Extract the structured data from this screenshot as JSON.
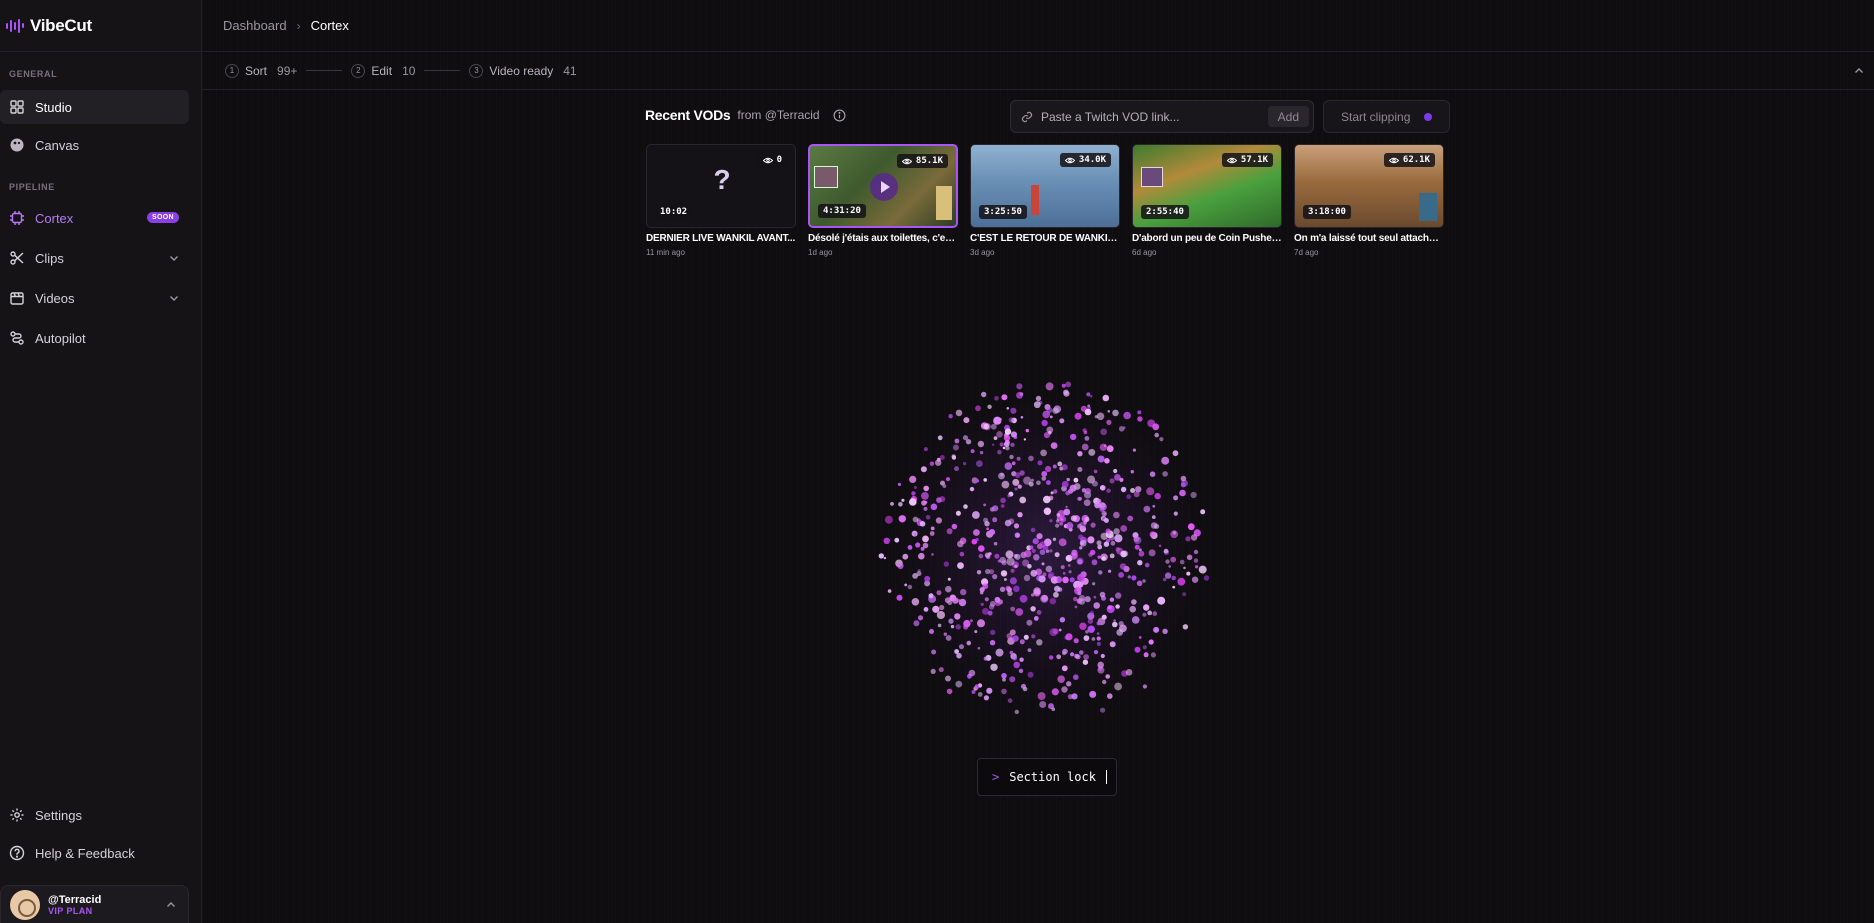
{
  "app": {
    "name": "VibeCut",
    "brand_color": "#a855f7"
  },
  "sidebar": {
    "general_label": "GENERAL",
    "pipeline_label": "PIPELINE",
    "items": [
      {
        "label": "Studio",
        "icon": "grid-icon"
      },
      {
        "label": "Canvas",
        "icon": "canvas-icon"
      },
      {
        "label": "Cortex",
        "icon": "cpu-icon",
        "badge": "SOON"
      },
      {
        "label": "Clips",
        "icon": "scissors-icon"
      },
      {
        "label": "Videos",
        "icon": "film-icon"
      },
      {
        "label": "Autopilot",
        "icon": "route-icon"
      }
    ],
    "settings": "Settings",
    "help": "Help & Feedback",
    "user": {
      "name": "@Terracid",
      "plan": "VIP PLAN"
    }
  },
  "breadcrumb": {
    "parent": "Dashboard",
    "current": "Cortex"
  },
  "steps": [
    {
      "num": "1",
      "label": "Sort",
      "count": "99+"
    },
    {
      "num": "2",
      "label": "Edit",
      "count": "10"
    },
    {
      "num": "3",
      "label": "Video ready",
      "count": "41"
    }
  ],
  "vods": {
    "title": "Recent VODs",
    "from": "from @Terracid",
    "input_placeholder": "Paste a Twitch VOD link...",
    "add_label": "Add",
    "start_label": "Start clipping",
    "items": [
      {
        "title": "DERNIER LIVE WANKIL AVANT...",
        "age": "11 min ago",
        "views": "0",
        "duration": "10:02",
        "thumb": "#141216"
      },
      {
        "title": "Désolé j'étais aux toilettes, c'es...",
        "age": "1d ago",
        "views": "85.1K",
        "duration": "4:31:20",
        "thumb": "#4d6a3a"
      },
      {
        "title": "C'EST LE RETOUR DE WANKIL ...",
        "age": "3d ago",
        "views": "34.0K",
        "duration": "3:25:50",
        "thumb": "#6f93b8"
      },
      {
        "title": "D'abord un peu de Coin Pusher...",
        "age": "6d ago",
        "views": "57.1K",
        "duration": "2:55:40",
        "thumb": "#4f8f3c"
      },
      {
        "title": "On m'a laissé tout seul attaché ...",
        "age": "7d ago",
        "views": "62.1K",
        "duration": "3:18:00",
        "thumb": "#9a6a3e"
      }
    ]
  },
  "terminal": {
    "prompt": ">",
    "text": "Section lock"
  }
}
